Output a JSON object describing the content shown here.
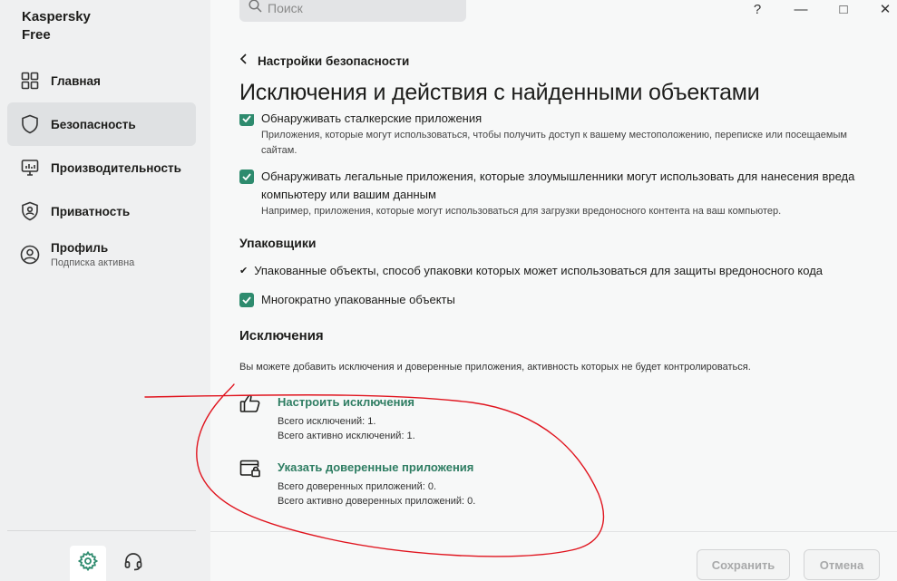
{
  "app": {
    "title_line1": "Kaspersky",
    "title_line2": "Free"
  },
  "sidebar": {
    "items": [
      {
        "label": "Главная",
        "icon": "dashboard-icon"
      },
      {
        "label": "Безопасность",
        "icon": "shield-icon",
        "active": true
      },
      {
        "label": "Производительность",
        "icon": "monitor-icon"
      },
      {
        "label": "Приватность",
        "icon": "privacy-shield-icon"
      },
      {
        "label": "Профиль",
        "sub": "Подписка активна",
        "icon": "profile-icon"
      }
    ],
    "bottom": {
      "settings_icon": "gear-icon",
      "support_icon": "headset-icon"
    }
  },
  "topbar": {
    "search_placeholder": "Поиск",
    "help": "?",
    "minimize": "—",
    "maximize": "□",
    "close": "✕"
  },
  "header": {
    "back_label": "Настройки безопасности",
    "title": "Исключения и действия с найденными объектами"
  },
  "content": {
    "stalker": {
      "label": "Обнаруживать сталкерские приложения",
      "desc": "Приложения, которые могут использоваться, чтобы получить доступ к вашему местоположению, переписке или посещаемым сайтам.",
      "checked": true
    },
    "legal": {
      "label": "Обнаруживать легальные приложения, которые злоумышленники могут использовать для нанесения вреда компьютеру или вашим данным",
      "desc": "Например, приложения, которые могут использоваться для загрузки вредоносного контента на ваш компьютер.",
      "checked": true
    },
    "packers": {
      "title": "Упаковщики",
      "packed_label": "Упакованные объекты, способ упаковки которых может использоваться для защиты вредоносного кода",
      "multi_label": "Многократно упакованные объекты"
    },
    "exclusions": {
      "title": "Исключения",
      "desc": "Вы можете добавить исключения и доверенные приложения, активность которых не будет контролироваться.",
      "configure": {
        "link": "Настроить исключения",
        "total": "Всего исключений: 1.",
        "active": "Всего активно исключений: 1."
      },
      "trusted": {
        "link": "Указать доверенные приложения",
        "total": "Всего доверенных приложений: 0.",
        "active": "Всего активно доверенных приложений: 0."
      }
    }
  },
  "footer": {
    "save": "Сохранить",
    "cancel": "Отмена"
  },
  "colors": {
    "accent": "#2e8b6e",
    "link": "#2e7d62",
    "annotation": "#e0141e"
  }
}
